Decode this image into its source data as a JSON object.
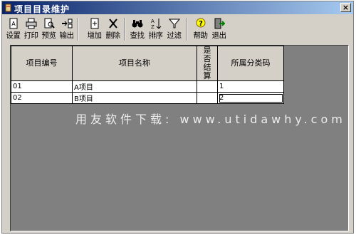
{
  "window": {
    "title": "项目目录维护",
    "close_glyph": "×"
  },
  "toolbar": [
    {
      "label": "设置",
      "icon": "settings-icon"
    },
    {
      "label": "打印",
      "icon": "printer-icon"
    },
    {
      "label": "预览",
      "icon": "preview-icon"
    },
    {
      "label": "输出",
      "icon": "export-icon"
    },
    {
      "label": "增加",
      "icon": "add-icon"
    },
    {
      "label": "删除",
      "icon": "delete-icon"
    },
    {
      "label": "查找",
      "icon": "binoculars-icon"
    },
    {
      "label": "排序",
      "icon": "sort-icon"
    },
    {
      "label": "过滤",
      "icon": "filter-icon"
    },
    {
      "label": "帮助",
      "icon": "help-icon"
    },
    {
      "label": "退出",
      "icon": "exit-icon"
    }
  ],
  "table": {
    "headers": [
      "项目编号",
      "项目名称",
      "是否结算",
      "所属分类码"
    ],
    "rows": [
      [
        "01",
        "A项目",
        "",
        "1"
      ],
      [
        "02",
        "B项目",
        "",
        "2"
      ]
    ]
  },
  "watermark": "用友软件下载: www.utidawhy.com",
  "colors": {
    "title_start": "#0a246a",
    "title_end": "#a6caf0",
    "face": "#d4d0c8",
    "grid_bg": "#808080"
  }
}
